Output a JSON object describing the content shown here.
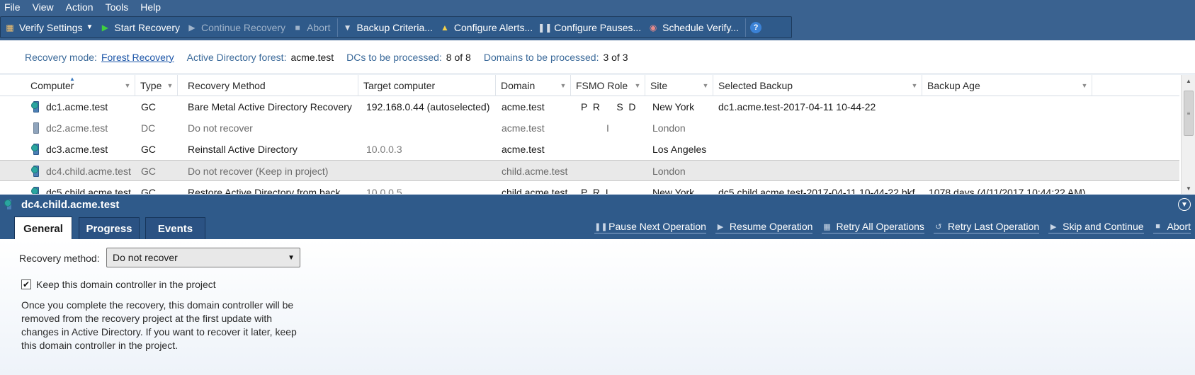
{
  "menu": [
    "File",
    "View",
    "Action",
    "Tools",
    "Help"
  ],
  "toolbar": {
    "verify_settings": "Verify Settings",
    "start_recovery": "Start Recovery",
    "continue_recovery": "Continue Recovery",
    "abort": "Abort",
    "backup_criteria": "Backup Criteria...",
    "configure_alerts": "Configure Alerts...",
    "configure_pauses": "Configure Pauses...",
    "schedule_verify": "Schedule Verify...",
    "help_icon": "help-icon"
  },
  "info": {
    "recovery_mode_label": "Recovery mode:",
    "recovery_mode_value": "Forest Recovery",
    "forest_label": "Active Directory forest:",
    "forest_value": "acme.test",
    "dcs_label": "DCs to be processed:",
    "dcs_value": "8 of 8",
    "domains_label": "Domains to be processed:",
    "domains_value": "3 of 3"
  },
  "grid": {
    "columns": [
      "Computer",
      "Type",
      "Recovery Method",
      "Target computer",
      "Domain",
      "FSMO Role",
      "Site",
      "Selected Backup",
      "Backup Age"
    ],
    "rows": [
      {
        "computer": "dc1.acme.test",
        "type": "GC",
        "method": "Bare Metal Active Directory Recovery",
        "target": "192.168.0.44 (autoselected)",
        "domain": "acme.test",
        "fsmo": "P  R      S  D",
        "site": "New York",
        "backup": "dc1.acme.test-2017-04-11 10-44-22",
        "age": ""
      },
      {
        "computer": "dc2.acme.test",
        "type": "DC",
        "method": "Do not recover",
        "target": "",
        "domain": "acme.test",
        "fsmo": "I",
        "site": "London",
        "backup": "",
        "age": ""
      },
      {
        "computer": "dc3.acme.test",
        "type": "GC",
        "method": "Reinstall Active Directory",
        "target": "10.0.0.3",
        "domain": "acme.test",
        "fsmo": "",
        "site": "Los Angeles",
        "backup": "",
        "age": ""
      },
      {
        "computer": "dc4.child.acme.test",
        "type": "GC",
        "method": "Do not recover (Keep in project)",
        "target": "",
        "domain": "child.acme.test",
        "fsmo": "",
        "site": "London",
        "backup": "",
        "age": ""
      },
      {
        "computer": "dc5.child.acme.test",
        "type": "GC",
        "method": "Restore Active Directory from back...",
        "target": "10.0.0.5",
        "domain": "child.acme.test",
        "fsmo": "P  R  I",
        "site": "New York",
        "backup": "dc5.child.acme.test-2017-04-11 10-44-22.bkf",
        "age": "1078 days (4/11/2017 10:44:22 AM)"
      }
    ]
  },
  "detail": {
    "title": "dc4.child.acme.test",
    "tabs": [
      "General",
      "Progress",
      "Events"
    ],
    "actions": [
      "Pause Next Operation",
      "Resume Operation",
      "Retry All Operations",
      "Retry Last Operation",
      "Skip and Continue",
      "Abort"
    ],
    "recovery_method_label": "Recovery method:",
    "recovery_method_value": "Do not recover",
    "keep_label": "Keep this domain controller in the project",
    "keep_checked": true,
    "note": "Once you complete the recovery, this domain controller will be removed from the recovery project at the first update with changes in Active Directory. If you want to recover it later, keep this domain controller in the project."
  },
  "colors": {
    "chrome": "#3a6290",
    "toolbar": "#2f5a8a",
    "link": "#1d56a8",
    "label": "#3b6a9a",
    "selected_row": "#e9e9e9"
  }
}
